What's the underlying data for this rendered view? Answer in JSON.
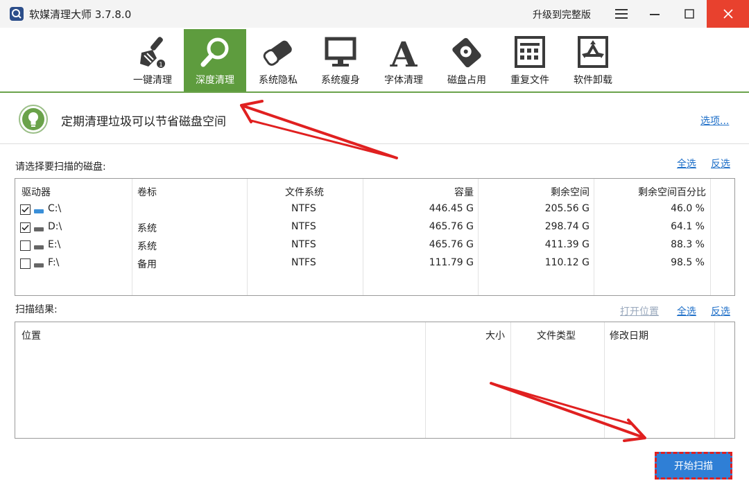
{
  "window": {
    "title": "软媒清理大师 3.7.8.0",
    "upgrade": "升级到完整版"
  },
  "toolbar": {
    "items": [
      {
        "label": "一键清理",
        "icon": "broom-icon"
      },
      {
        "label": "深度清理",
        "icon": "magnifier-icon",
        "active": true
      },
      {
        "label": "系统隐私",
        "icon": "eraser-icon"
      },
      {
        "label": "系统瘦身",
        "icon": "monitor-icon"
      },
      {
        "label": "字体清理",
        "icon": "font-icon"
      },
      {
        "label": "磁盘占用",
        "icon": "disk-icon"
      },
      {
        "label": "重复文件",
        "icon": "duplicate-file-icon"
      },
      {
        "label": "软件卸载",
        "icon": "recycle-icon"
      }
    ]
  },
  "tip": {
    "text": "定期清理垃圾可以节省磁盘空间",
    "options": "选项..."
  },
  "disks": {
    "label": "请选择要扫描的磁盘:",
    "select_all": "全选",
    "invert": "反选",
    "headers": [
      "驱动器",
      "卷标",
      "文件系统",
      "容量",
      "剩余空间",
      "剩余空间百分比"
    ],
    "rows": [
      {
        "checked": true,
        "drive": "C:\\",
        "label": "",
        "fs": "NTFS",
        "capacity": "446.45 G",
        "free": "205.56 G",
        "pct": "46.0 %"
      },
      {
        "checked": true,
        "drive": "D:\\",
        "label": "系统",
        "fs": "NTFS",
        "capacity": "465.76 G",
        "free": "298.74 G",
        "pct": "64.1 %"
      },
      {
        "checked": false,
        "drive": "E:\\",
        "label": "系统",
        "fs": "NTFS",
        "capacity": "465.76 G",
        "free": "411.39 G",
        "pct": "88.3 %"
      },
      {
        "checked": false,
        "drive": "F:\\",
        "label": "备用",
        "fs": "NTFS",
        "capacity": "111.79 G",
        "free": "110.12 G",
        "pct": "98.5 %"
      }
    ]
  },
  "results": {
    "label": "扫描结果:",
    "open_location": "打开位置",
    "select_all": "全选",
    "invert": "反选",
    "headers": [
      "位置",
      "大小",
      "文件类型",
      "修改日期"
    ]
  },
  "start_button": "开始扫描",
  "colors": {
    "accent_green": "#5e9c3e",
    "link_blue": "#1e6fc8",
    "close_red": "#e8412e",
    "button_blue": "#2f7fd6",
    "annotation_red": "#e02020"
  }
}
